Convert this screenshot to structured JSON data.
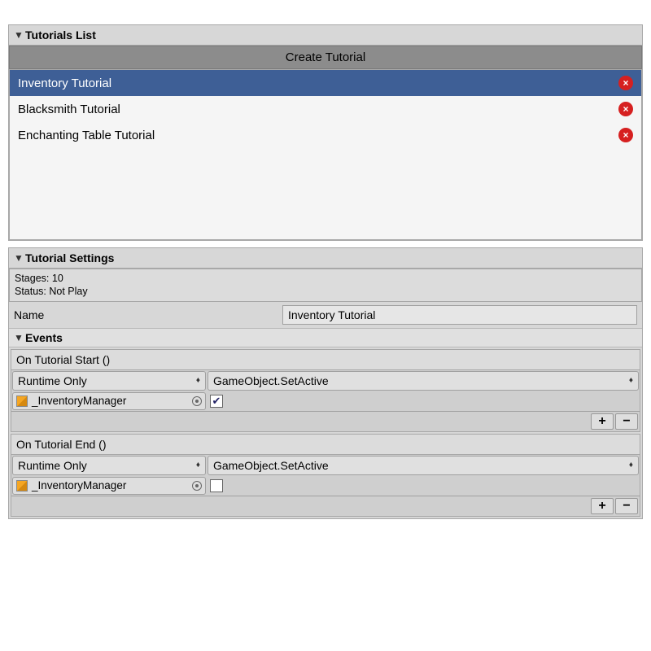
{
  "tutorials_list": {
    "title": "Tutorials List",
    "create_btn": "Create Tutorial",
    "items": [
      {
        "name": "Inventory Tutorial",
        "selected": true
      },
      {
        "name": "Blacksmith Tutorial",
        "selected": false
      },
      {
        "name": "Enchanting Table Tutorial",
        "selected": false
      }
    ]
  },
  "settings": {
    "title": "Tutorial Settings",
    "stages_label": "Stages: 10",
    "status_label": "Status: Not Play",
    "name_label": "Name",
    "name_value": "Inventory Tutorial"
  },
  "events": {
    "title": "Events",
    "start": {
      "label": "On Tutorial Start ()",
      "runtime": "Runtime Only",
      "func": "GameObject.SetActive",
      "obj": "_InventoryManager",
      "checked": true
    },
    "end": {
      "label": "On Tutorial End ()",
      "runtime": "Runtime Only",
      "func": "GameObject.SetActive",
      "obj": "_InventoryManager",
      "checked": false
    },
    "plus": "+",
    "minus": "−"
  }
}
